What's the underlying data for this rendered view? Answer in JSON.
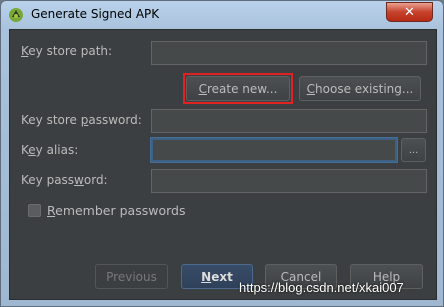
{
  "window": {
    "title": "Generate Signed APK",
    "close_icon": "close-x-icon"
  },
  "form": {
    "key_store_path_label": "Key store path:",
    "key_store_path_value": "",
    "create_new_label": "Create new...",
    "choose_existing_label": "Choose existing...",
    "key_store_password_label": "Key store password:",
    "key_store_password_value": "",
    "key_alias_label": "Key alias:",
    "key_alias_value": "",
    "browse_label": "...",
    "key_password_label": "Key password:",
    "key_password_value": "",
    "remember_passwords_label": "Remember passwords",
    "remember_passwords_checked": false
  },
  "footer": {
    "previous_label": "Previous",
    "next_label": "Next",
    "cancel_label": "Cancel",
    "help_label": "Help"
  },
  "watermark": "https://blog.csdn.net/xkai007",
  "colors": {
    "dialog_bg": "#3c3f41",
    "highlight_box": "#e02222",
    "default_button": "#384c68"
  }
}
